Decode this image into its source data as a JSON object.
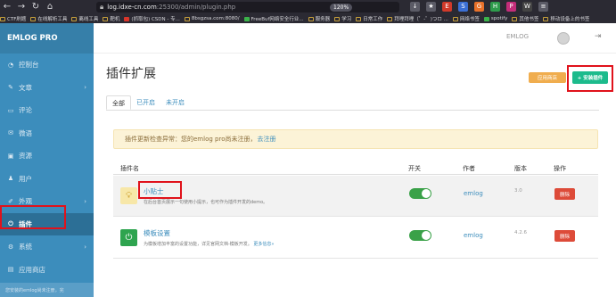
{
  "browser": {
    "url_host": "log.idxe-cn.com",
    "url_path": ":25300/admin/plugin.php",
    "zoom": "120%",
    "bookmarks": [
      "CTF刷题",
      "在线解析工具",
      "离线工具",
      "靶机",
      "(抓取包) CSDN - 专...",
      "8bsgzsa.com:8080/",
      "FreeBuf网络安全行业...",
      "服务器",
      "学习",
      "日常工作",
      "拜哩拜哩（゜-゜)つロ ...",
      "网络书签",
      "spotify",
      "其他书签",
      "移动设备上的书签"
    ]
  },
  "sidebar": {
    "brand": "EMLOG PRO",
    "items": [
      {
        "label": "控制台",
        "icon": "dashboard-icon"
      },
      {
        "label": "文章",
        "icon": "pencil-icon",
        "chevron": true
      },
      {
        "label": "评论",
        "icon": "comment-icon"
      },
      {
        "label": "微语",
        "icon": "note-icon"
      },
      {
        "label": "资源",
        "icon": "image-icon"
      },
      {
        "label": "用户",
        "icon": "user-icon"
      },
      {
        "label": "外观",
        "icon": "brush-icon",
        "chevron": true
      },
      {
        "label": "插件",
        "icon": "plug-icon",
        "active": true
      },
      {
        "label": "系统",
        "icon": "gear-icon",
        "chevron": true
      },
      {
        "label": "应用商店",
        "icon": "store-icon"
      }
    ],
    "footer": "您安装的emlog尚未注册，完"
  },
  "header": {
    "user": "EMLOG"
  },
  "main": {
    "title": "插件扩展",
    "store_button": "应用商店",
    "install_button": "+ 安装插件",
    "tabs": [
      "全部",
      "已开启",
      "未开启"
    ],
    "alert_text": "插件更新检查异常：您的emlog pro尚未注册，",
    "alert_link": "去注册",
    "columns": [
      "插件名",
      "开关",
      "作者",
      "版本",
      "操作"
    ],
    "plugins": [
      {
        "name": "小贴士",
        "desc": "在后台首页展示一句使用小提示，也可作为插件开发的demo。",
        "more": "",
        "enabled": true,
        "author": "emlog",
        "version": "3.0",
        "action": "删除"
      },
      {
        "name": "模板设置",
        "desc": "为模板增加丰富的设置功能，详见官网文档-模板开发。",
        "more": "更多信息»",
        "enabled": true,
        "author": "emlog",
        "version": "4.2.6",
        "action": "删除"
      }
    ]
  },
  "colors": {
    "sidebar": "#3c8dbc",
    "annotation": "#e0121b",
    "toggle_on": "#3aa148",
    "delete": "#dd4b39",
    "install": "#1cbb8c",
    "store": "#f0ad4e"
  }
}
